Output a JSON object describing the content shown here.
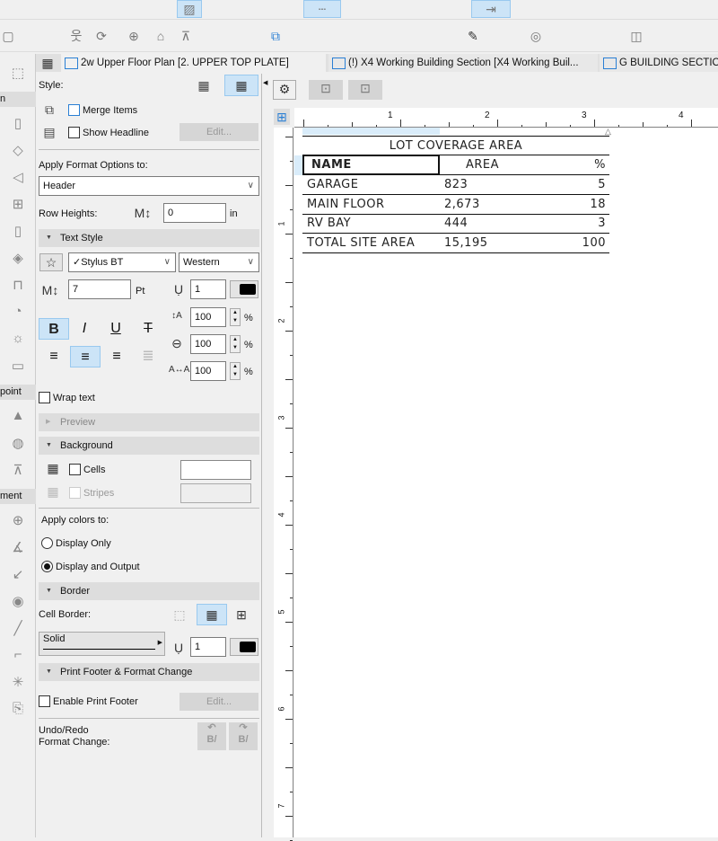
{
  "tabs": [
    {
      "label": "2w Upper Floor Plan [2. UPPER TOP PLATE]",
      "icon": "floor-plan-icon"
    },
    {
      "label": "(!) X4 Working Building Section [X4 Working Buil...",
      "icon": "section-icon"
    },
    {
      "label": "G BUILDING SECTION",
      "icon": "section-icon"
    }
  ],
  "toolbox": {
    "headers": [
      "n",
      "point",
      "ment"
    ]
  },
  "panel": {
    "style_label": "Style:",
    "merge_items": "Merge Items",
    "merge_checked": false,
    "show_headline": "Show Headline",
    "show_headline_checked": false,
    "edit_label": "Edit...",
    "apply_format_label": "Apply Format Options to:",
    "apply_format_value": "Header",
    "row_heights_label": "Row Heights:",
    "row_heights_value": "0",
    "row_heights_unit": "in",
    "text_style": {
      "title": "Text Style",
      "font": "✓Stylus BT",
      "script": "Western",
      "size": "7",
      "size_unit": "Pt",
      "pen": "1",
      "spacing": "100",
      "width": "100",
      "char_spacing": "100",
      "pct": "%",
      "bold": "B",
      "italic": "I",
      "underline": "U",
      "strike": "T",
      "bold_active": true,
      "align": "center"
    },
    "wrap_text": "Wrap text",
    "wrap_checked": false,
    "preview": "Preview",
    "background": {
      "title": "Background",
      "cells": "Cells",
      "stripes": "Stripes"
    },
    "apply_colors_label": "Apply colors to:",
    "display_only": "Display Only",
    "display_output": "Display and Output",
    "selected": "Display and Output",
    "border": {
      "title": "Border",
      "cell_border_label": "Cell Border:",
      "line_type": "Solid",
      "pen": "1"
    },
    "print_footer": {
      "title": "Print Footer & Format Change",
      "enable": "Enable Print Footer",
      "enabled": false,
      "edit": "Edit..."
    },
    "undo_label_1": "Undo/Redo",
    "undo_label_2": "Format Change:",
    "undo_icon_text": "B/"
  },
  "ruler": {
    "top": [
      "1",
      "2",
      "3",
      "4"
    ],
    "left": [
      "1",
      "2",
      "3",
      "4",
      "5",
      "6",
      "7"
    ]
  },
  "schedule": {
    "title": "LOT COVERAGE AREA",
    "headers": [
      "NAME",
      "AREA",
      "%"
    ],
    "rows": [
      [
        "GARAGE",
        "823",
        "5"
      ],
      [
        "MAIN FLOOR",
        "2,673",
        "18"
      ],
      [
        "RV BAY",
        "444",
        "3"
      ],
      [
        "TOTAL SITE AREA",
        "15,195",
        "100"
      ]
    ]
  },
  "colors": {
    "accent": "#cce4f7",
    "icon_blue": "#2a7fd4"
  }
}
